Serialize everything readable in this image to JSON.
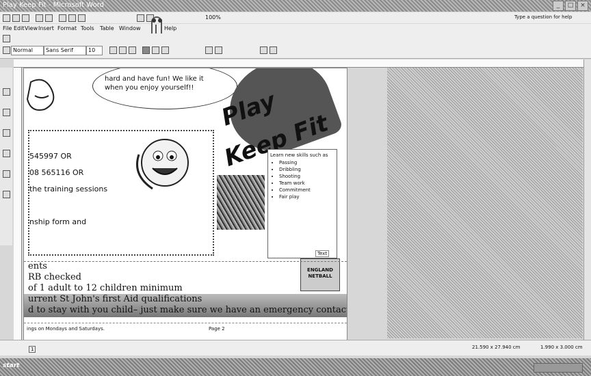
{
  "window": {
    "title": "Play Keep Fit - Microsoft Word"
  },
  "menu": [
    "File",
    "Edit",
    "View",
    "Insert",
    "Format",
    "Tools",
    "Table",
    "Window",
    "Help"
  ],
  "toolbar": {
    "zoom": "100%",
    "style": "Normal",
    "font": "Sans Serif",
    "size": "10",
    "help_box": "Type a question for help"
  },
  "bubble": [
    "hard and have fun! We like it",
    "when you enjoy yourself!!"
  ],
  "contact": [
    "545997 OR",
    "08 565116 OR",
    "the training sessions",
    "nship form and"
  ],
  "title_words": [
    "Play",
    "Keep Fit"
  ],
  "skills": {
    "intro": "Learn new skills such as",
    "items": [
      "Passing",
      "Dribbling",
      "Shooting",
      "Team work",
      "Commitment",
      "Fair play"
    ]
  },
  "textbox_label": "Text",
  "badge": "ENGLAND NETBALL",
  "bottom_lines": [
    "ents",
    "RB checked",
    "of 1 adult to 12 children minimum",
    "urrent St John's first Aid qualifications",
    "d to stay with you child– just make sure we have an emergency contact num-"
  ],
  "footer": {
    "left": "ings on Mondays and Saturdays.",
    "center": "Page 2"
  },
  "status": {
    "page": "1",
    "pos": "21.590 x 27.940 cm",
    "size": "1.990 x 3.000 cm"
  },
  "taskbar": {
    "start": "start"
  }
}
